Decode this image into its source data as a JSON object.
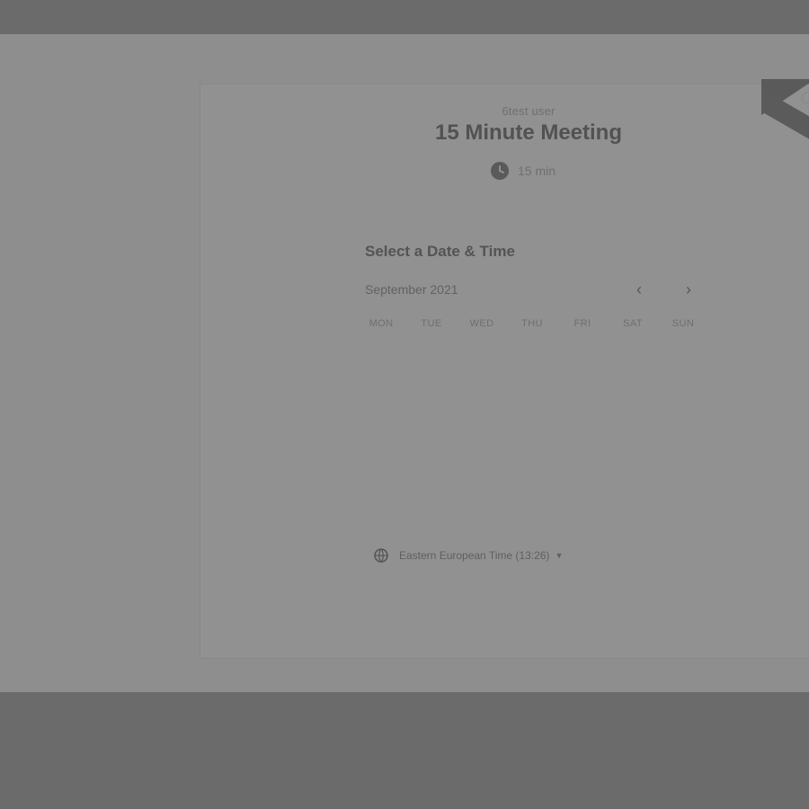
{
  "event": {
    "owner": "6test user",
    "title": "15 Minute Meeting",
    "duration": "15 min"
  },
  "scheduler": {
    "section_title": "Select a Date & Time",
    "month": "September 2021",
    "weekdays": [
      "MON",
      "TUE",
      "WED",
      "THU",
      "FRI",
      "SAT",
      "SUN"
    ],
    "timezone_label": "Eastern European Time (13:26)"
  },
  "icons": {
    "clock": "clock-icon",
    "globe": "globe-icon",
    "prev": "chevron-left-icon",
    "next": "chevron-right-icon",
    "caret": "caret-down-icon"
  },
  "colors": {
    "overlay": "#8e8e8e",
    "chrome": "#6b6b6b",
    "card": "#919191"
  }
}
